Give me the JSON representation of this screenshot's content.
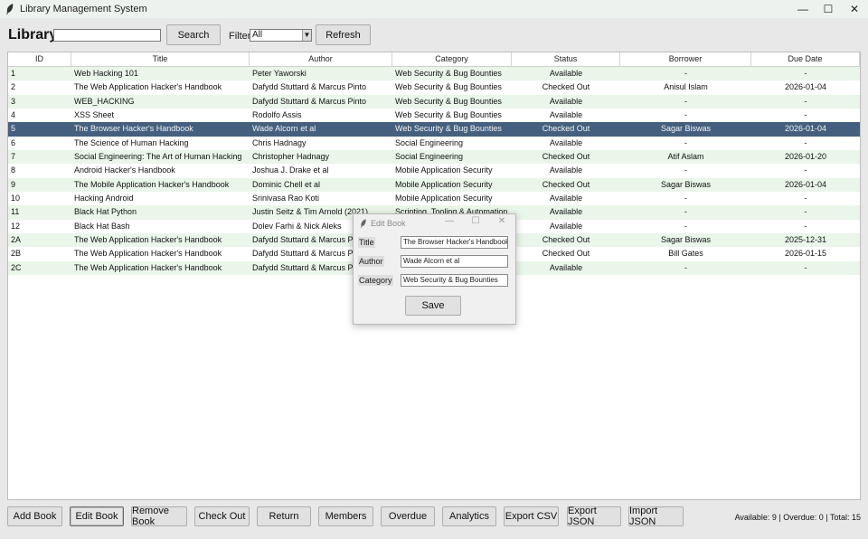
{
  "window": {
    "title": "Library Management System",
    "icon": "feather-icon"
  },
  "toolbar": {
    "app_title": "Library",
    "search_value": "",
    "search_label": "Search",
    "filter_label": "Filter:",
    "filter_value": "All",
    "refresh_label": "Refresh"
  },
  "table": {
    "columns": [
      "ID",
      "Title",
      "Author",
      "Category",
      "Status",
      "Borrower",
      "Due Date"
    ],
    "rows": [
      [
        "1",
        "Web Hacking 101",
        "Peter Yaworski",
        "Web Security & Bug Bounties",
        "Available",
        "-",
        "-"
      ],
      [
        "2",
        "The Web Application Hacker's Handbook",
        "Dafydd Stuttard & Marcus Pinto",
        "Web Security & Bug Bounties",
        "Checked Out",
        "Anisul Islam",
        "2026-01-04"
      ],
      [
        "3",
        "WEB_HACKING",
        "Dafydd Stuttard & Marcus Pinto",
        "Web Security & Bug Bounties",
        "Available",
        "-",
        "-"
      ],
      [
        "4",
        "XSS Sheet",
        "Rodolfo Assis",
        "Web Security & Bug Bounties",
        "Available",
        "-",
        "-"
      ],
      [
        "5",
        "The Browser Hacker's Handbook",
        "Wade Alcorn et al",
        "Web Security & Bug Bounties",
        "Checked Out",
        "Sagar Biswas",
        "2026-01-04"
      ],
      [
        "6",
        "The Science of Human Hacking",
        "Chris Hadnagy",
        "Social Engineering",
        "Available",
        "-",
        "-"
      ],
      [
        "7",
        "Social Engineering: The Art of Human Hacking",
        "Christopher Hadnagy",
        "Social Engineering",
        "Checked Out",
        "Atif Aslam",
        "2026-01-20"
      ],
      [
        "8",
        "Android Hacker's Handbook",
        "Joshua J. Drake et al",
        "Mobile Application Security",
        "Available",
        "-",
        "-"
      ],
      [
        "9",
        "The Mobile Application Hacker's Handbook",
        "Dominic Chell et al",
        "Mobile Application Security",
        "Checked Out",
        "Sagar Biswas",
        "2026-01-04"
      ],
      [
        "10",
        "Hacking Android",
        "Srinivasa Rao Koti",
        "Mobile Application Security",
        "Available",
        "-",
        "-"
      ],
      [
        "11",
        "Black Hat Python",
        "Justin Seitz & Tim Arnold (2021)",
        "Scripting, Tooling & Automation",
        "Available",
        "-",
        "-"
      ],
      [
        "12",
        "Black Hat Bash",
        "Dolev Farhi & Nick Aleks",
        "",
        "Available",
        "-",
        "-"
      ],
      [
        "2A",
        "The Web Application Hacker's Handbook",
        "Dafydd Stuttard & Marcus Pinto",
        "",
        "Checked Out",
        "Sagar Biswas",
        "2025-12-31"
      ],
      [
        "2B",
        "The Web Application Hacker's Handbook",
        "Dafydd Stuttard & Marcus Pinto",
        "",
        "Checked Out",
        "Bill Gates",
        "2026-01-15"
      ],
      [
        "2C",
        "The Web Application Hacker's Handbook",
        "Dafydd Stuttard & Marcus Pinto",
        "",
        "Available",
        "-",
        "-"
      ]
    ],
    "selected_row": 4
  },
  "dialog": {
    "title": "Edit Book",
    "fields": [
      {
        "label": "Title",
        "value": "The Browser Hacker's Handbook"
      },
      {
        "label": "Author",
        "value": "Wade Alcorn et al"
      },
      {
        "label": "Category",
        "value": "Web Security & Bug Bounties"
      }
    ],
    "save_label": "Save"
  },
  "bottom": {
    "buttons": [
      "Add Book",
      "Edit Book",
      "Remove Book",
      "Check Out",
      "Return",
      "Members",
      "Overdue",
      "Analytics",
      "Export CSV",
      "Export JSON",
      "Import JSON"
    ],
    "active_button": "Edit Book",
    "status": "Available: 9 | Overdue: 0 | Total: 15"
  },
  "colors": {
    "selected_row": "#44607e",
    "even_row": "#e9f6e9",
    "odd_row": "#ffffff"
  }
}
